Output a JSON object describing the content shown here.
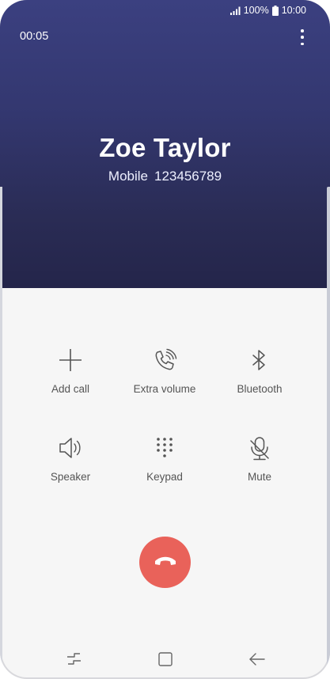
{
  "status_bar": {
    "battery": "100%",
    "time": "10:00",
    "icons": [
      "signal-icon",
      "battery-icon"
    ]
  },
  "call": {
    "duration": "00:05",
    "name": "Zoe Taylor",
    "number_type": "Mobile",
    "number": "123456789"
  },
  "controls": [
    {
      "label": "Add call",
      "icon": "plus-icon"
    },
    {
      "label": "Extra volume",
      "icon": "phone-volume-icon"
    },
    {
      "label": "Bluetooth",
      "icon": "bluetooth-icon"
    },
    {
      "label": "Speaker",
      "icon": "speaker-icon"
    },
    {
      "label": "Keypad",
      "icon": "keypad-icon"
    },
    {
      "label": "Mute",
      "icon": "mic-muted-icon"
    }
  ],
  "end_call": {
    "icon": "end-call-icon",
    "color": "#e9625a"
  },
  "navbar": {
    "icons": [
      "recent-apps-icon",
      "home-icon",
      "back-icon"
    ]
  },
  "colors": {
    "header_top": "#3b4080",
    "header_bottom": "#24254a",
    "background": "#f6f6f6",
    "label": "#555555"
  }
}
